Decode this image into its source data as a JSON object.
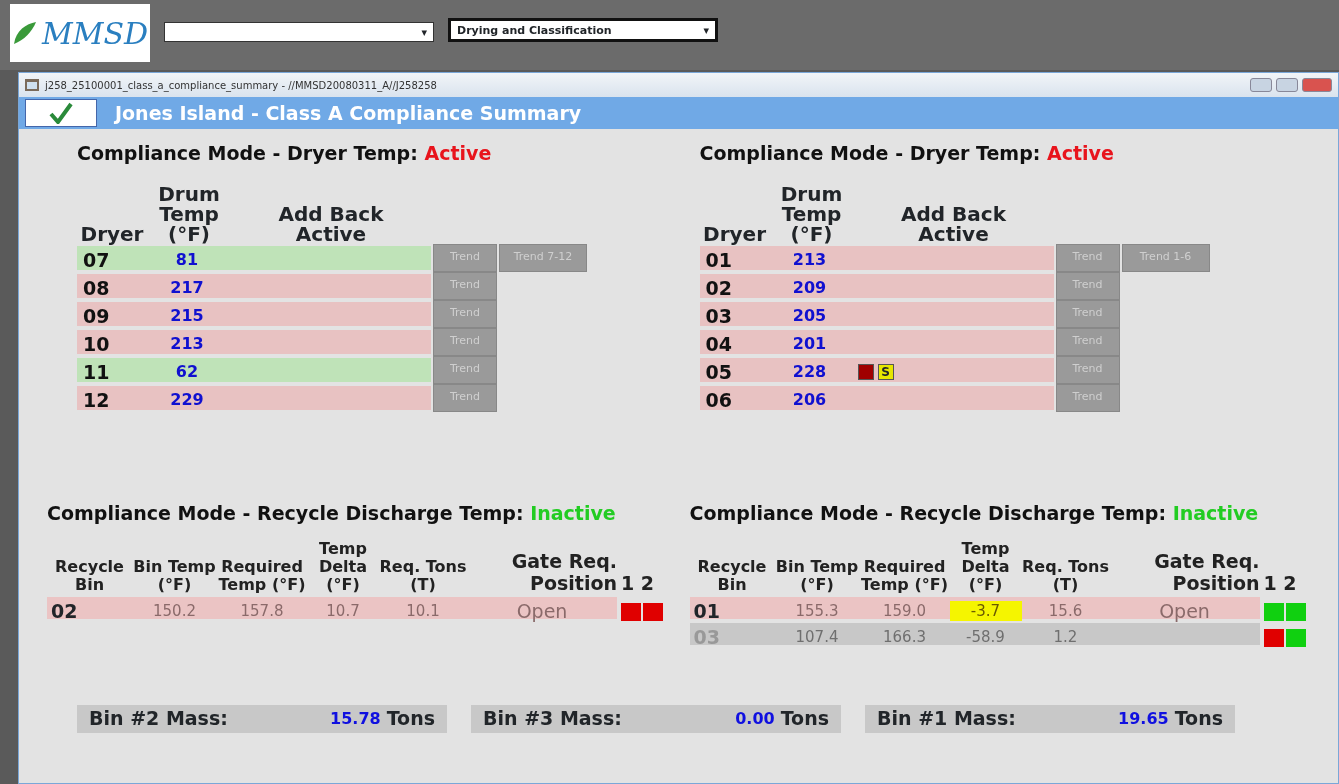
{
  "backdrop": {
    "logo": "MMSD",
    "combos": [
      {
        "arrow": "▾"
      },
      {
        "value": "Drying and Classification",
        "arrow": "▾"
      }
    ]
  },
  "window": {
    "title": "j258_25100001_class_a_compliance_summary - //MMSD20080311_A//J258258",
    "header": "Jones Island - Class A Compliance Summary"
  },
  "dryer_panels": [
    {
      "title": "Compliance Mode - Dryer Temp:",
      "mode": "Active",
      "mode_active": true,
      "columns": [
        "Dryer",
        "Drum Temp (°F)",
        "Add Back Active"
      ],
      "group_trend": "Trend 7-12",
      "rows": [
        {
          "dryer": "07",
          "temp": "81",
          "alarm": false,
          "trend": "Trend"
        },
        {
          "dryer": "08",
          "temp": "217",
          "alarm": true,
          "trend": "Trend"
        },
        {
          "dryer": "09",
          "temp": "215",
          "alarm": true,
          "trend": "Trend"
        },
        {
          "dryer": "10",
          "temp": "213",
          "alarm": true,
          "trend": "Trend"
        },
        {
          "dryer": "11",
          "temp": "62",
          "alarm": false,
          "trend": "Trend"
        },
        {
          "dryer": "12",
          "temp": "229",
          "alarm": true,
          "trend": "Trend"
        }
      ]
    },
    {
      "title": "Compliance Mode - Dryer Temp:",
      "mode": "Active",
      "mode_active": true,
      "columns": [
        "Dryer",
        "Drum Temp (°F)",
        "Add Back Active"
      ],
      "group_trend": "Trend 1-6",
      "rows": [
        {
          "dryer": "01",
          "temp": "213",
          "alarm": true,
          "trend": "Trend"
        },
        {
          "dryer": "02",
          "temp": "209",
          "alarm": true,
          "trend": "Trend"
        },
        {
          "dryer": "03",
          "temp": "205",
          "alarm": true,
          "trend": "Trend"
        },
        {
          "dryer": "04",
          "temp": "201",
          "alarm": true,
          "trend": "Trend"
        },
        {
          "dryer": "05",
          "temp": "228",
          "alarm": true,
          "trend": "Trend",
          "flags": [
            {
              "color": "#a00000"
            },
            {
              "color": "#e6e600",
              "label": "S"
            }
          ]
        },
        {
          "dryer": "06",
          "temp": "206",
          "alarm": true,
          "trend": "Trend"
        }
      ]
    }
  ],
  "recycle_panels": [
    {
      "title": "Compliance Mode - Recycle Discharge Temp:",
      "mode": "Inactive",
      "mode_active": false,
      "columns": [
        "Recycle Bin",
        "Bin Temp (°F)",
        "Required Temp (°F)",
        "Temp Delta (°F)",
        "Req. Tons (T)",
        "Gate Req. Position",
        "1 2"
      ],
      "rows": [
        {
          "bin": "02",
          "kind": "active",
          "bin_temp": "150.2",
          "req_temp": "157.8",
          "delta": "10.7",
          "delta_alert": false,
          "tons": "10.1",
          "position": "Open",
          "gates": [
            {
              "color": "#e00000"
            },
            {
              "color": "#e00000"
            }
          ]
        }
      ]
    },
    {
      "title": "Compliance Mode - Recycle Discharge Temp:",
      "mode": "Inactive",
      "mode_active": false,
      "columns": [
        "Recycle Bin",
        "Bin Temp (°F)",
        "Required Temp (°F)",
        "Temp Delta (°F)",
        "Req. Tons (T)",
        "Gate Req. Position",
        "1 2"
      ],
      "rows": [
        {
          "bin": "01",
          "kind": "active",
          "bin_temp": "155.3",
          "req_temp": "159.0",
          "delta": "-3.7",
          "delta_alert": true,
          "tons": "15.6",
          "position": "Open",
          "gates": [
            {
              "color": "#10d010"
            },
            {
              "color": "#10d010"
            }
          ]
        },
        {
          "bin": "03",
          "kind": "offline",
          "bin_temp": "107.4",
          "req_temp": "166.3",
          "delta": "-58.9",
          "delta_alert": false,
          "tons": "1.2",
          "gates": [
            {
              "color": "#e00000"
            },
            {
              "color": "#10d010"
            }
          ]
        }
      ]
    }
  ],
  "masses": [
    {
      "label": "Bin #2 Mass:",
      "value": "15.78",
      "unit": "Tons"
    },
    {
      "label": "Bin #3 Mass:",
      "value": "0.00",
      "unit": "Tons"
    },
    {
      "label": "Bin #1 Mass:",
      "value": "19.65",
      "unit": "Tons"
    }
  ]
}
